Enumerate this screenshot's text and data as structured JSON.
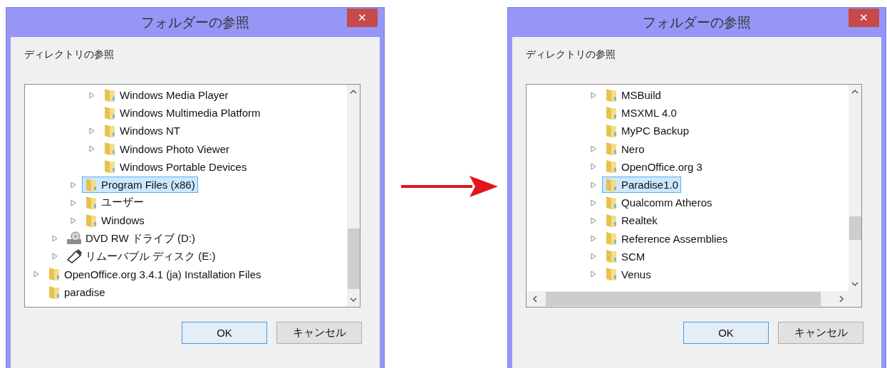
{
  "dialogs": [
    {
      "title": "フォルダーの参照",
      "close": "✕",
      "prompt": "ディレクトリの参照",
      "horizontal_scrollbar": false,
      "tree": [
        {
          "children": [
            {
              "children": [
                {
                  "children": [
                    {
                      "label": "Windows Media Player",
                      "kind": "folder",
                      "expandable": true,
                      "selected": false
                    },
                    {
                      "label": "Windows Multimedia Platform",
                      "kind": "folder",
                      "expandable": false,
                      "selected": false
                    },
                    {
                      "label": "Windows NT",
                      "kind": "folder",
                      "expandable": true,
                      "selected": false
                    },
                    {
                      "label": "Windows Photo Viewer",
                      "kind": "folder",
                      "expandable": true,
                      "selected": false
                    },
                    {
                      "label": "Windows Portable Devices",
                      "kind": "folder",
                      "expandable": false,
                      "selected": false
                    }
                  ]
                },
                {
                  "label": "Program Files (x86)",
                  "kind": "folder",
                  "expandable": true,
                  "selected": true
                },
                {
                  "label": "ユーザー",
                  "kind": "folder",
                  "expandable": true,
                  "selected": false
                },
                {
                  "label": "Windows",
                  "kind": "folder",
                  "expandable": true,
                  "selected": false
                }
              ]
            },
            {
              "label": "DVD RW ドライブ (D:)",
              "kind": "dvd",
              "expandable": true,
              "selected": false
            },
            {
              "label": "リムーバブル ディスク (E:)",
              "kind": "usb",
              "expandable": true,
              "selected": false
            }
          ]
        },
        {
          "label": "OpenOffice.org 3.4.1 (ja) Installation Files",
          "kind": "folder",
          "expandable": true,
          "selected": false
        },
        {
          "label": "paradise",
          "kind": "folder",
          "expandable": false,
          "selected": false
        }
      ],
      "buttons": [
        {
          "label": "OK",
          "default": true
        },
        {
          "label": "キャンセル",
          "default": false
        }
      ]
    },
    {
      "title": "フォルダーの参照",
      "close": "✕",
      "prompt": "ディレクトリの参照",
      "horizontal_scrollbar": true,
      "tree": [
        {
          "children": [
            {
              "children": [
                {
                  "children": [
                    {
                      "label": "MSBuild",
                      "kind": "folder",
                      "expandable": true,
                      "selected": false
                    },
                    {
                      "label": "MSXML 4.0",
                      "kind": "folder",
                      "expandable": false,
                      "selected": false
                    },
                    {
                      "label": "MyPC Backup",
                      "kind": "folder",
                      "expandable": false,
                      "selected": false
                    },
                    {
                      "label": "Nero",
                      "kind": "folder",
                      "expandable": true,
                      "selected": false
                    },
                    {
                      "label": "OpenOffice.org 3",
                      "kind": "folder",
                      "expandable": true,
                      "selected": false
                    },
                    {
                      "label": "Paradise1.0",
                      "kind": "folder",
                      "expandable": true,
                      "selected": true
                    },
                    {
                      "label": "Qualcomm Atheros",
                      "kind": "folder",
                      "expandable": true,
                      "selected": false
                    },
                    {
                      "label": "Realtek",
                      "kind": "folder",
                      "expandable": true,
                      "selected": false
                    },
                    {
                      "label": "Reference Assemblies",
                      "kind": "folder",
                      "expandable": true,
                      "selected": false
                    },
                    {
                      "label": "SCM",
                      "kind": "folder",
                      "expandable": true,
                      "selected": false
                    },
                    {
                      "label": "Venus",
                      "kind": "folder",
                      "expandable": true,
                      "selected": false
                    }
                  ]
                }
              ]
            }
          ]
        }
      ],
      "buttons": [
        {
          "label": "OK",
          "default": true
        },
        {
          "label": "キャンセル",
          "default": false
        }
      ]
    }
  ]
}
